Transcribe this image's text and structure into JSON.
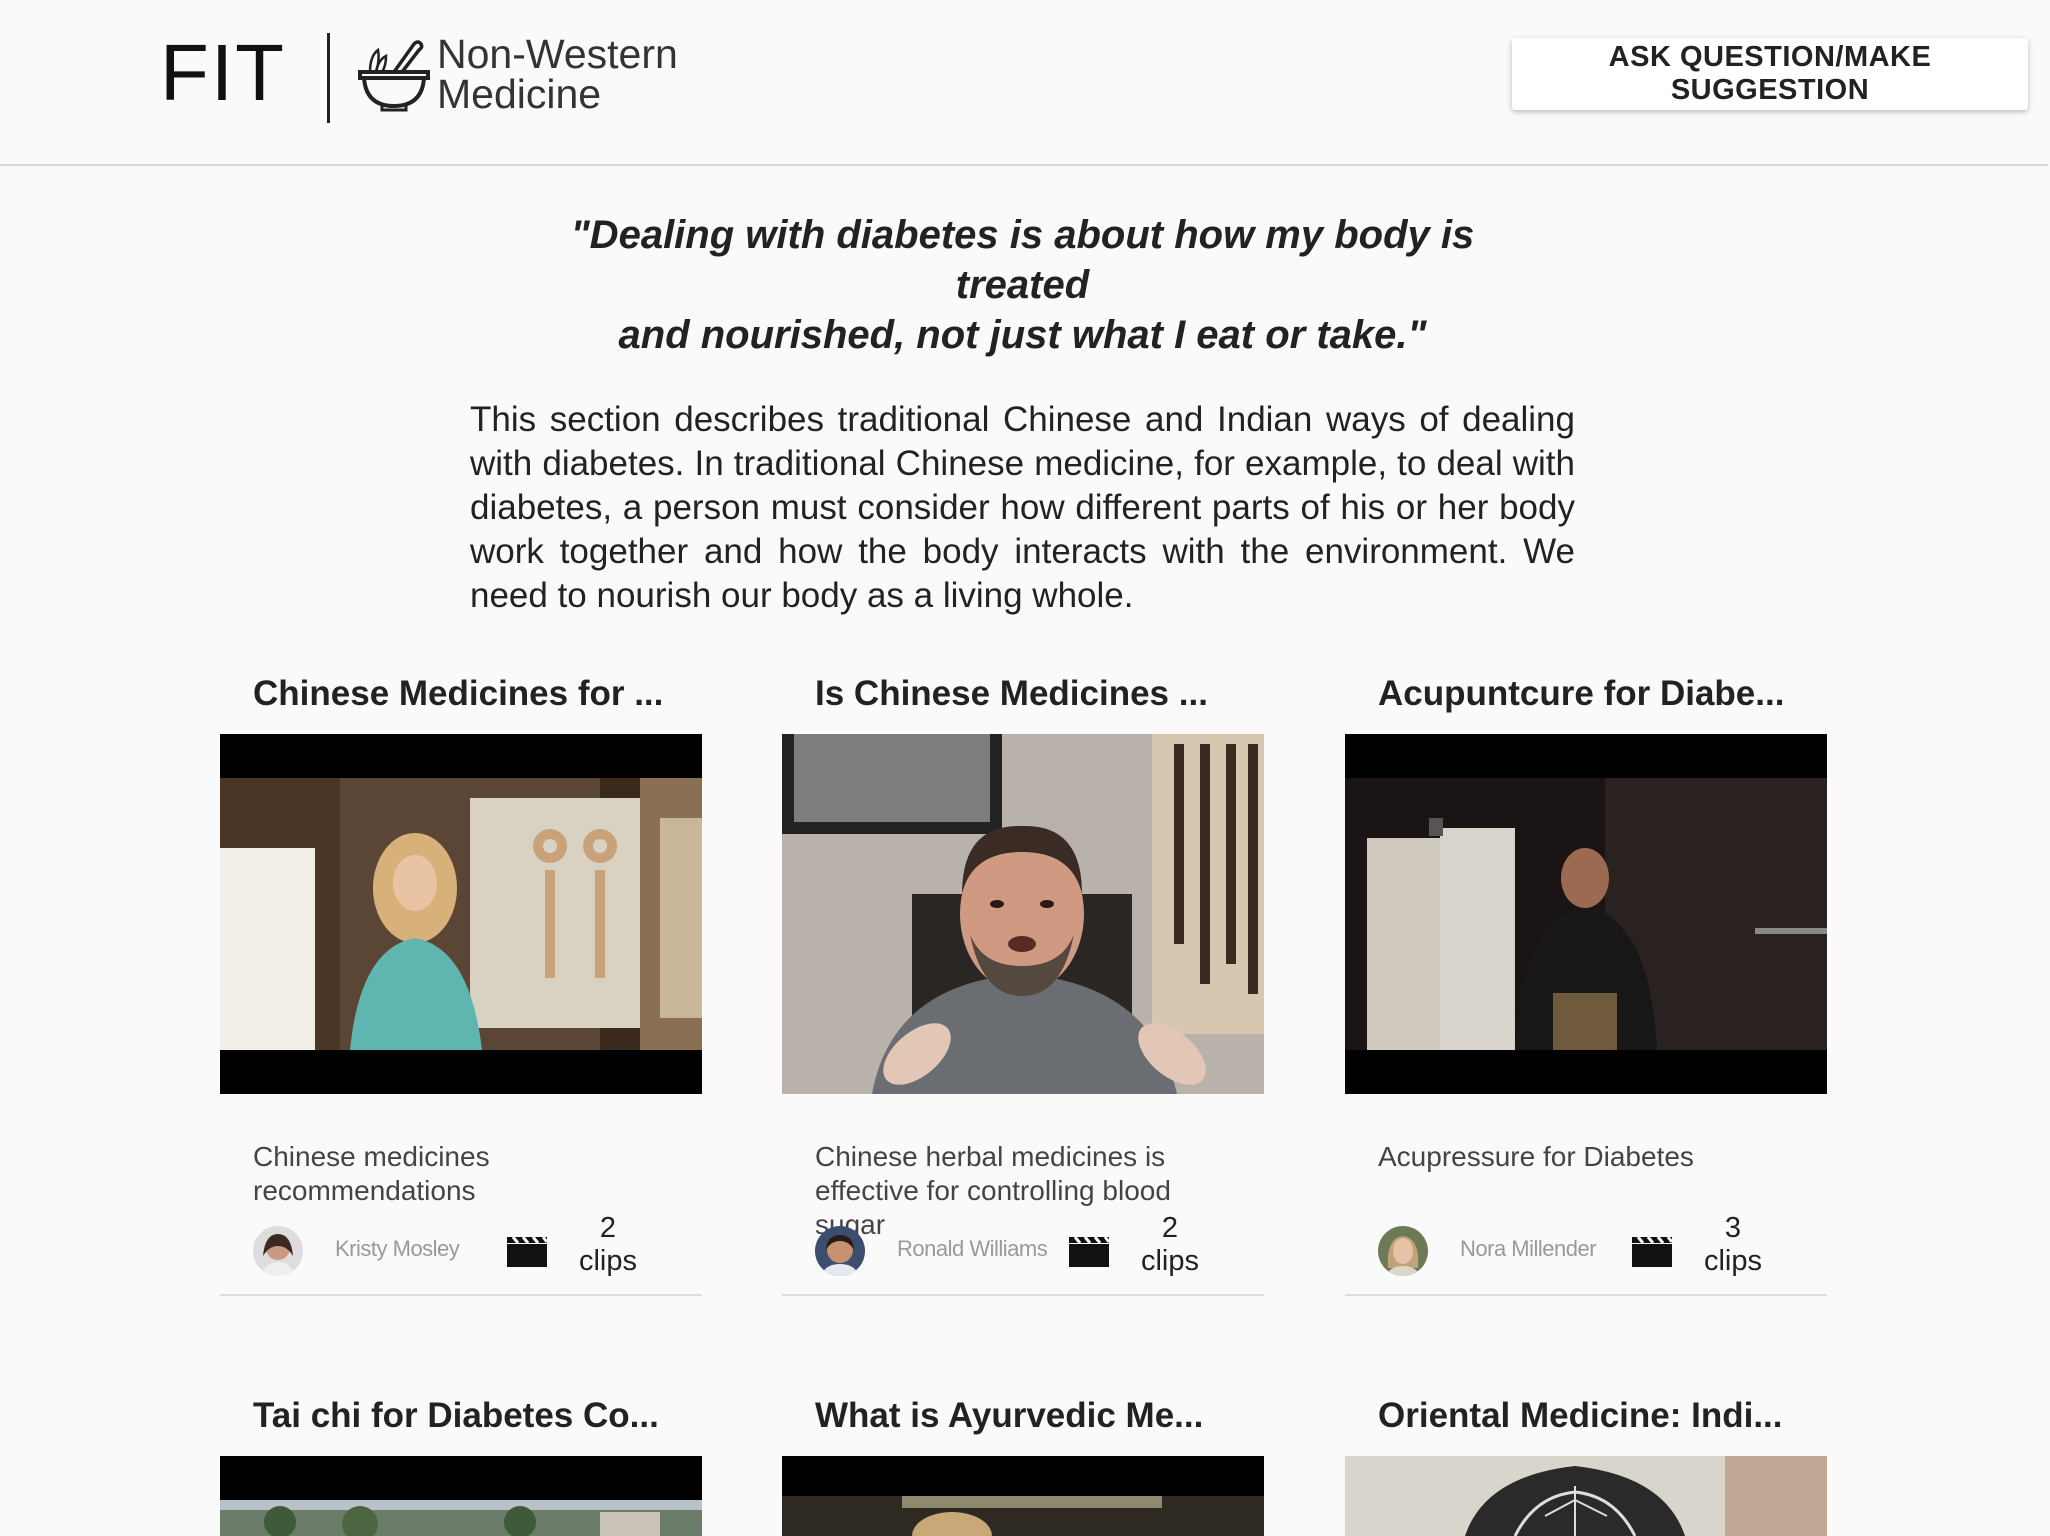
{
  "header": {
    "brand": "FIT",
    "logo_line1": "Non-Western",
    "logo_line2": "Medicine",
    "logo_icon": "mortar-pestle-icon",
    "ask_button": "ASK QUESTION/MAKE SUGGESTION"
  },
  "intro": {
    "quote_line1": "\"Dealing with diabetes is about how my body is treated",
    "quote_line2": "and nourished, not just what I eat or take.\"",
    "description": "This section describes traditional Chinese and Indian ways of dealing with diabetes. In traditional Chinese medicine, for example, to deal with diabetes, a person must consider how different parts of his or her body work together and how the body interacts with the environment. We need to nourish our body as a living whole."
  },
  "cards": [
    {
      "title": "Chinese Medicines for ...",
      "subtitle": "Chinese medicines recommendations",
      "author": "Kristy Mosley",
      "clips_count": "2",
      "clips_label": "clips"
    },
    {
      "title": "Is Chinese Medicines ...",
      "subtitle": "Chinese herbal medicines is effective for controlling blood sugar",
      "author": "Ronald Williams",
      "clips_count": "2",
      "clips_label": "clips"
    },
    {
      "title": "Acupuntcure for Diabe...",
      "subtitle": "Acupressure for Diabetes",
      "author": "Nora Millender",
      "clips_count": "3",
      "clips_label": "clips"
    },
    {
      "title": "Tai chi for Diabetes Co..."
    },
    {
      "title": "What is Ayurvedic Me..."
    },
    {
      "title": "Oriental Medicine: Indi..."
    }
  ],
  "colors": {
    "background": "#fafafa",
    "text": "#222222",
    "muted": "#999999",
    "divider": "#dddddd"
  }
}
